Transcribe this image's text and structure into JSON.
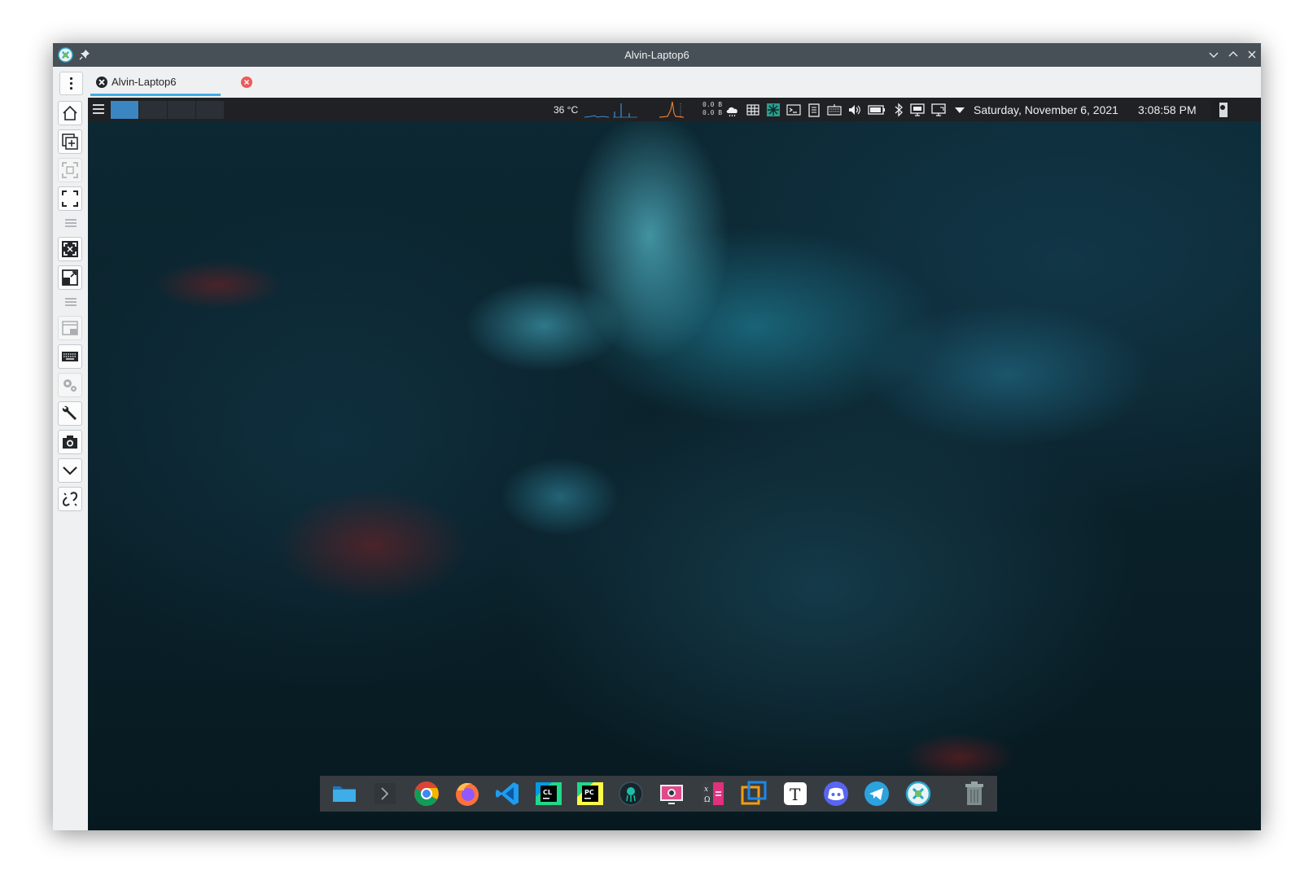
{
  "window": {
    "title": "Alvin-Laptop6",
    "titlebar_color": "#475057"
  },
  "tabs": [
    {
      "label": "Alvin-Laptop6",
      "active": true
    }
  ],
  "accent_color": "#3daee9",
  "sidebar": {
    "buttons": [
      {
        "icon": "home-icon",
        "enabled": true
      },
      {
        "icon": "new-window-icon",
        "enabled": true
      },
      {
        "icon": "scaled-view-icon",
        "enabled": false
      },
      {
        "icon": "fullscreen-icon",
        "enabled": true
      },
      {
        "icon": "fit-window-icon",
        "enabled": true
      },
      {
        "icon": "resize-fit-icon",
        "enabled": true
      },
      {
        "icon": "view-mode-icon",
        "enabled": false
      },
      {
        "icon": "keyboard-icon",
        "enabled": true
      },
      {
        "icon": "gears-icon",
        "enabled": false
      },
      {
        "icon": "wrench-icon",
        "enabled": true
      },
      {
        "icon": "camera-icon",
        "enabled": true
      },
      {
        "icon": "chevron-down-icon",
        "enabled": true
      },
      {
        "icon": "disconnect-icon",
        "enabled": true
      }
    ]
  },
  "remote_panel": {
    "temperature": "36 °C",
    "network_up": "0.0 B",
    "network_down": "0.0 B",
    "date": "Saturday, November 6, 2021",
    "time": "3:08:58 PM",
    "pager_desktops": 4,
    "active_desktop": 1,
    "tray_icons": [
      "weather-icon",
      "grid-icon",
      "network-icon",
      "terminal-icon",
      "clipboard-icon",
      "keyboard-layout-icon",
      "volume-icon",
      "battery-icon",
      "bluetooth-icon",
      "display-icon",
      "screen-icon",
      "expand-tray-icon"
    ]
  },
  "dock": {
    "apps": [
      "files-icon",
      "terminal-icon",
      "chrome-icon",
      "firefox-icon",
      "vscode-icon",
      "clion-icon",
      "pycharm-icon",
      "gitkraken-icon",
      "screenshot-icon",
      "math-icon",
      "virtualbox-icon",
      "typora-icon",
      "discord-icon",
      "telegram-icon",
      "remote-desktop-icon",
      "trash-icon"
    ]
  }
}
